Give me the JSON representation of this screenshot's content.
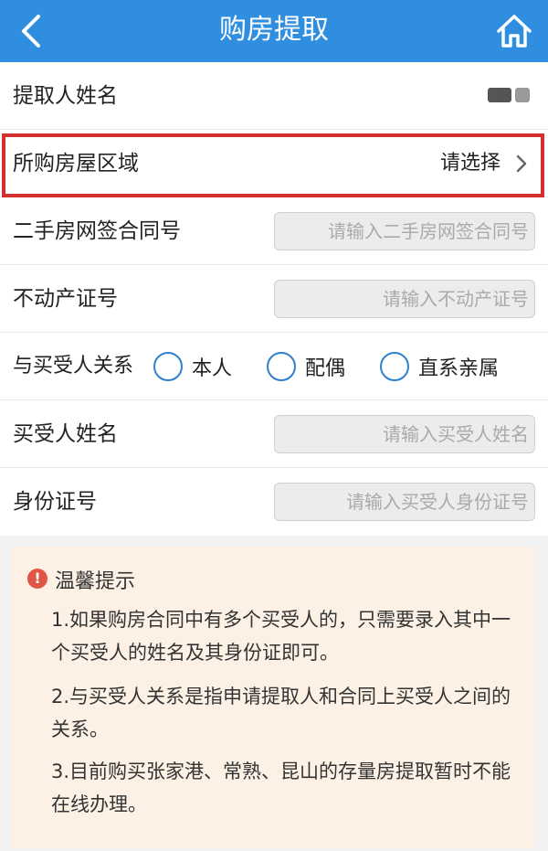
{
  "header": {
    "title": "购房提取",
    "back_icon": "chevron-left-icon",
    "home_icon": "home-icon",
    "color": "#2f8ee0"
  },
  "form": {
    "applicant_name_label": "提取人姓名",
    "region_label": "所购房屋区域",
    "region_value": "请选择",
    "contract_label": "二手房网签合同号",
    "contract_placeholder": "请输入二手房网签合同号",
    "property_label": "不动产证号",
    "property_placeholder": "请输入不动产证号",
    "relation_label": "与买受人关系",
    "relation_options": [
      "本人",
      "配偶",
      "直系亲属"
    ],
    "buyer_name_label": "买受人姓名",
    "buyer_name_placeholder": "请输入买受人姓名",
    "id_label": "身份证号",
    "id_placeholder": "请输入买受人身份证号"
  },
  "tips": {
    "title": "温馨提示",
    "items": [
      "1.如果购房合同中有多个买受人的，只需要录入其中一个买受人的姓名及其身份证即可。",
      "2.与买受人关系是指申请提取人和合同上买受人之间的关系。",
      "3.目前购买张家港、常熟、昆山的存量房提取暂时不能在线办理。"
    ],
    "background": "#fdf1e6",
    "warn_color": "#e05546"
  },
  "highlight_color": "#d32f2f"
}
